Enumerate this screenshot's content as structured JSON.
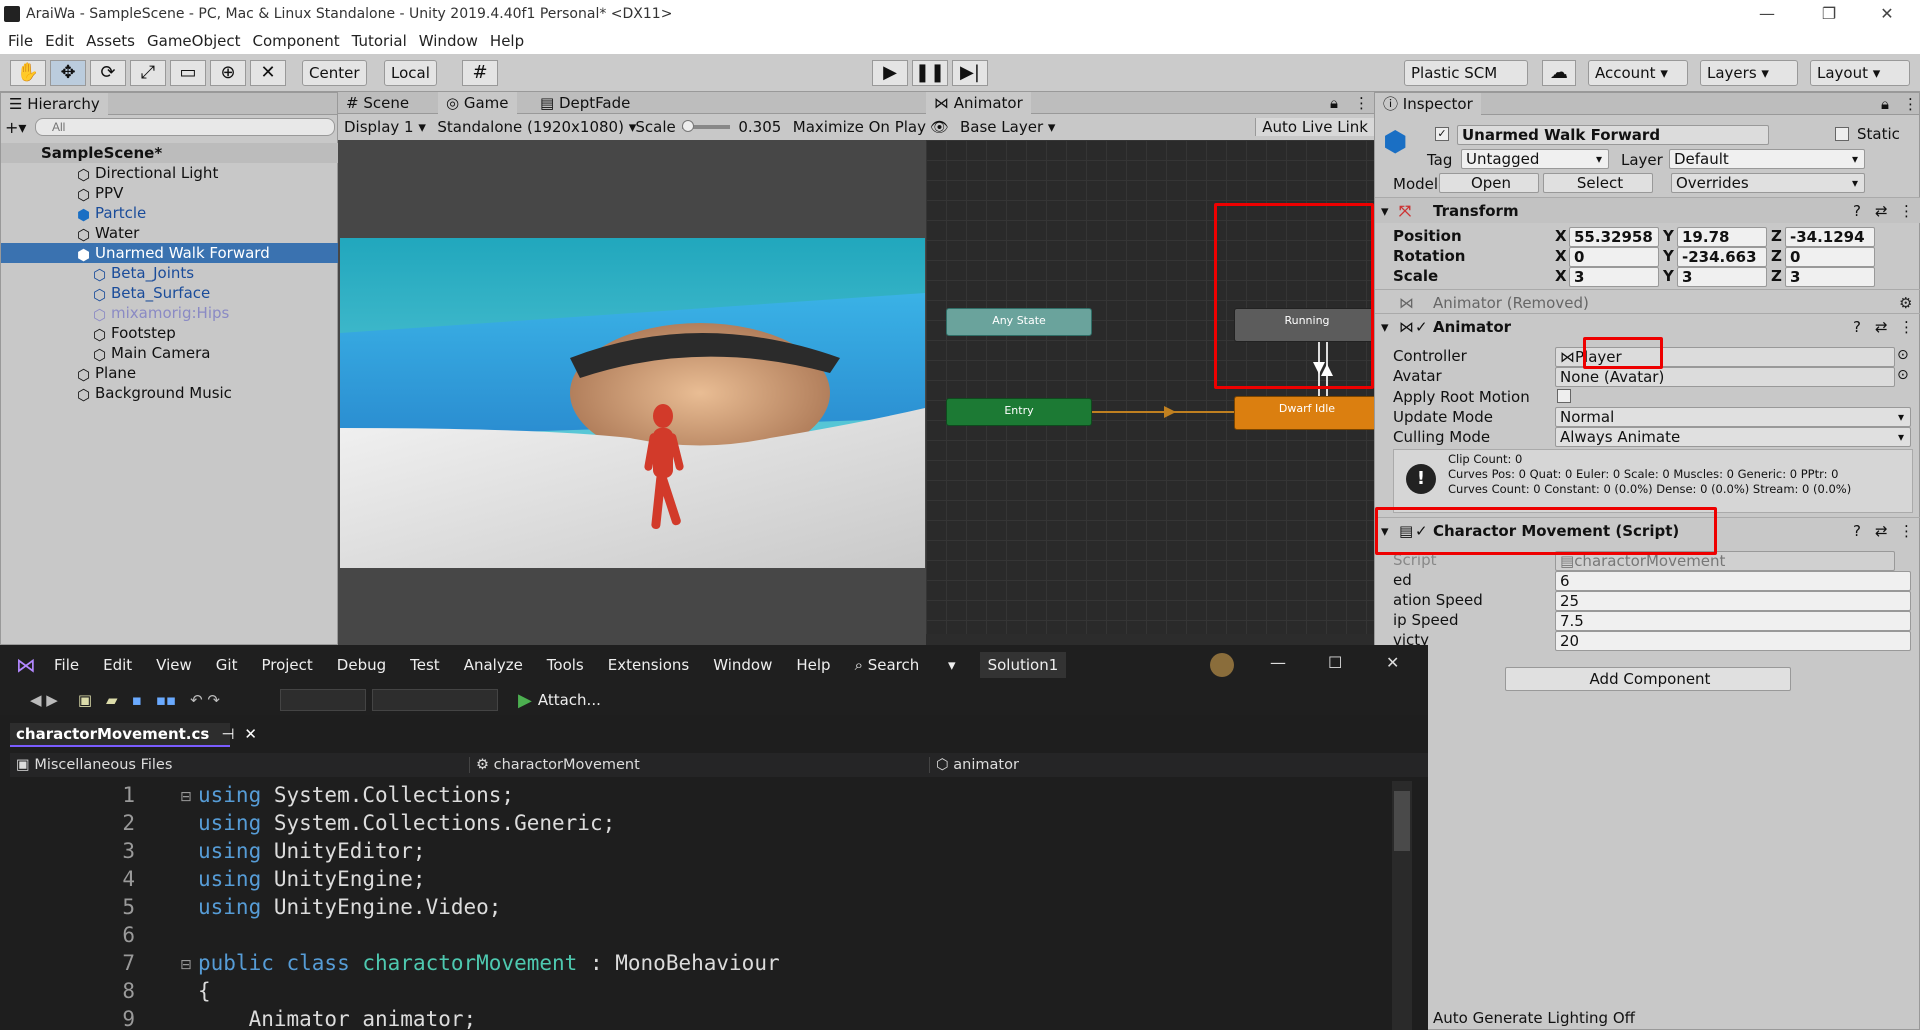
{
  "window": {
    "title": "AraiWa - SampleScene - PC, Mac & Linux Standalone - Unity 2019.4.40f1 Personal* <DX11>"
  },
  "menu": [
    "File",
    "Edit",
    "Assets",
    "GameObject",
    "Component",
    "Tutorial",
    "Window",
    "Help"
  ],
  "toolbar": {
    "center": "Center",
    "local": "Local",
    "plastic": "Plastic SCM",
    "account": "Account",
    "layers": "Layers",
    "layout": "Layout"
  },
  "hierarchy": {
    "tab": "Hierarchy",
    "search_placeholder": "All",
    "scene": "SampleScene*",
    "items": [
      {
        "label": "Directional Light"
      },
      {
        "label": "PPV"
      },
      {
        "label": "Partcle"
      },
      {
        "label": "Water"
      },
      {
        "label": "Unarmed Walk Forward"
      },
      {
        "label": "Beta_Joints"
      },
      {
        "label": "Beta_Surface"
      },
      {
        "label": "mixamorig:Hips"
      },
      {
        "label": "Footstep"
      },
      {
        "label": "Main Camera"
      },
      {
        "label": "Plane"
      },
      {
        "label": "Background Music"
      }
    ]
  },
  "game": {
    "tabs": [
      "Scene",
      "Game",
      "DeptFade"
    ],
    "display": "Display 1",
    "resolution": "Standalone (1920x1080)",
    "scale_label": "Scale",
    "scale_value": "0.305",
    "maximize": "Maximize On Play"
  },
  "animator": {
    "tab": "Animator",
    "layer": "Base Layer",
    "auto_live": "Auto Live Link",
    "nodes": {
      "any": "Any State",
      "entry": "Entry",
      "running": "Running",
      "idle": "Dwarf Idle"
    }
  },
  "inspector": {
    "tab": "Inspector",
    "object_name": "Unarmed Walk Forward",
    "static": "Static",
    "tag_label": "Tag",
    "tag": "Untagged",
    "layer_label": "Layer",
    "layer": "Default",
    "model_label": "Model",
    "open": "Open",
    "select": "Select",
    "overrides": "Overrides",
    "transform": {
      "title": "Transform",
      "position": "Position",
      "rotation": "Rotation",
      "scale": "Scale",
      "pos": [
        "55.32958",
        "19.78",
        "-34.1294"
      ],
      "rot": [
        "0",
        "-234.663",
        "0"
      ],
      "scl": [
        "3",
        "3",
        "3"
      ]
    },
    "animator_removed": "Animator (Removed)",
    "animator": {
      "title": "Animator",
      "controller_label": "Controller",
      "controller": "Player",
      "avatar_label": "Avatar",
      "avatar": "None (Avatar)",
      "root_motion": "Apply Root Motion",
      "update_label": "Update Mode",
      "update": "Normal",
      "culling_label": "Culling Mode",
      "culling": "Always Animate",
      "info1": "Clip Count: 0",
      "info2": "Curves Pos: 0 Quat: 0 Euler: 0 Scale: 0 Muscles: 0 Generic: 0 PPtr: 0",
      "info3": "Curves Count: 0 Constant: 0 (0.0%) Dense: 0 (0.0%) Stream: 0 (0.0%)"
    },
    "script": {
      "title": "Charactor Movement (Script)",
      "script_label": "Script",
      "script_value": "charactorMovement",
      "f1_label": "ed",
      "f1": "6",
      "f2_label": "ation Speed",
      "f2": "25",
      "f3_label": "ip Speed",
      "f3": "7.5",
      "f4_label": "victy",
      "f4": "20"
    },
    "add_component": "Add Component",
    "status": "Auto Generate Lighting Off"
  },
  "vs": {
    "menu": [
      "File",
      "Edit",
      "View",
      "Git",
      "Project",
      "Debug",
      "Test",
      "Analyze",
      "Tools",
      "Extensions",
      "Window",
      "Help"
    ],
    "search": "Search",
    "solution": "Solution1",
    "attach": "Attach...",
    "doc_tab": "charactorMovement.cs",
    "nav1": "Miscellaneous Files",
    "nav2": "charactorMovement",
    "nav3": "animator",
    "lines": [
      {
        "n": "1",
        "kw": "using",
        "rest": " System.Collections;"
      },
      {
        "n": "2",
        "kw": "using",
        "rest": " System.Collections.Generic;"
      },
      {
        "n": "3",
        "kw": "using",
        "rest": " UnityEditor;"
      },
      {
        "n": "4",
        "kw": "using",
        "rest": " UnityEngine;"
      },
      {
        "n": "5",
        "kw": "using",
        "rest": " UnityEngine.Video;"
      },
      {
        "n": "6",
        "kw": "",
        "rest": ""
      },
      {
        "n": "7",
        "kw": "public class",
        "ty": "charactorMovement",
        "rest": " : MonoBehaviour"
      },
      {
        "n": "8",
        "kw": "",
        "rest": "{"
      },
      {
        "n": "9",
        "kw": "",
        "rest": "    Animator animator;"
      }
    ]
  }
}
